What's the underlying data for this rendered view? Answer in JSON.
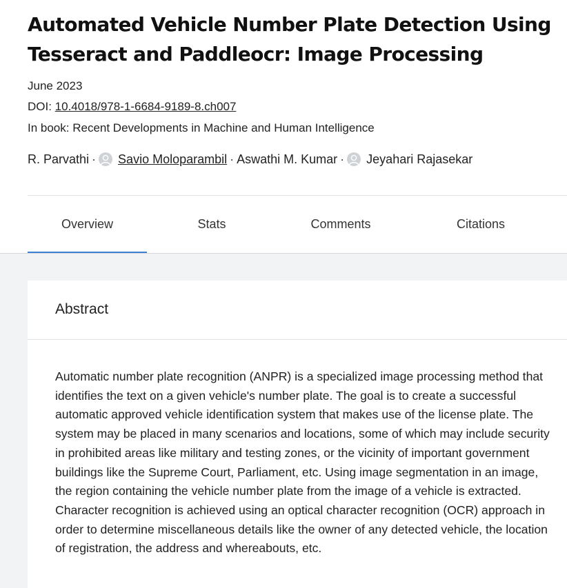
{
  "publication": {
    "title": "Automated Vehicle Number Plate Detection Using Tesseract and Paddleocr: Image Processing",
    "date": "June 2023",
    "doi_prefix": "DOI: ",
    "doi": "10.4018/978-1-6684-9189-8.ch007",
    "book_prefix": "In book: ",
    "book": "Recent Developments in Machine and Human Intelligence"
  },
  "authors": [
    {
      "name": "R. Parvathi",
      "avatar": false,
      "linked": false
    },
    {
      "name": "Savio Moloparambil",
      "avatar": true,
      "linked": true
    },
    {
      "name": "Aswathi M. Kumar",
      "avatar": false,
      "linked": false
    },
    {
      "name": "Jeyahari Rajasekar",
      "avatar": true,
      "linked": false
    }
  ],
  "author_separator": "·",
  "tabs": [
    {
      "label": "Overview",
      "active": true
    },
    {
      "label": "Stats",
      "active": false
    },
    {
      "label": "Comments",
      "active": false
    },
    {
      "label": "Citations",
      "active": false
    }
  ],
  "abstract": {
    "heading": "Abstract",
    "text": "Automatic number plate recognition (ANPR) is a specialized image processing method that identifies the text on a given vehicle's number plate. The goal is to create a successful automatic approved vehicle identification system that makes use of the license plate. The system may be placed in many scenarios and locations, some of which may include security in prohibited areas like military and testing zones, or the vicinity of important government buildings like the Supreme Court, Parliament, etc. Using image segmentation in an image, the region containing the vehicle number plate from the image of a vehicle is extracted. Character recognition is achieved using an optical character recognition (OCR) approach in order to determine miscellaneous details like the owner of any detected vehicle, the location of registration, the address and whereabouts, etc."
  },
  "colors": {
    "accent": "#3d7fd6",
    "page_background": "#f2f3f5",
    "avatar_placeholder": "#cfd2d6"
  },
  "icons": {
    "avatar": "user-avatar-placeholder-icon"
  }
}
